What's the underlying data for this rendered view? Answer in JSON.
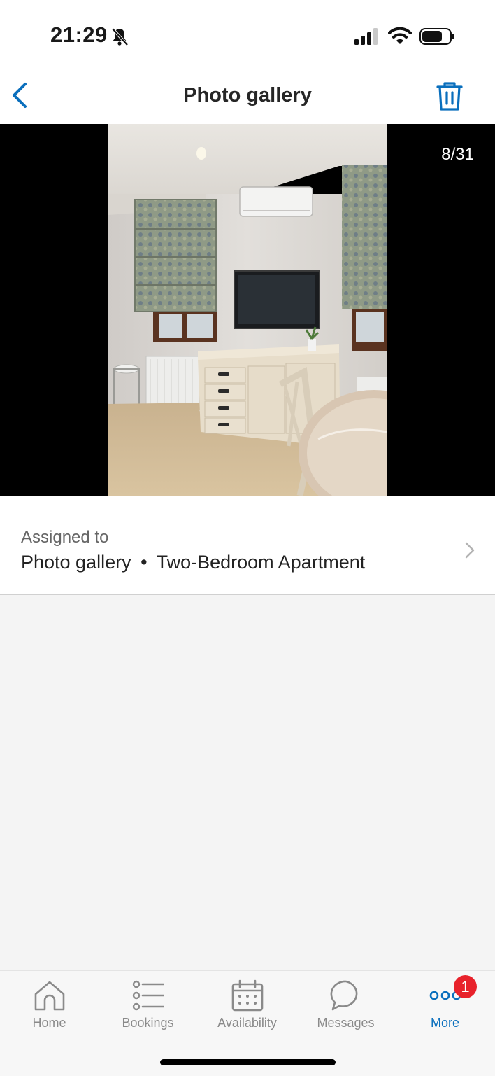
{
  "status": {
    "time": "21:29"
  },
  "header": {
    "title": "Photo gallery"
  },
  "gallery": {
    "counter": "8/31"
  },
  "assigned": {
    "label": "Assigned to",
    "gallery": "Photo gallery",
    "separator": "•",
    "unit": "Two-Bedroom Apartment"
  },
  "tabs": [
    {
      "label": "Home",
      "icon": "home-icon"
    },
    {
      "label": "Bookings",
      "icon": "list-icon"
    },
    {
      "label": "Availability",
      "icon": "calendar-icon"
    },
    {
      "label": "Messages",
      "icon": "chat-icon"
    },
    {
      "label": "More",
      "icon": "more-icon",
      "badge": "1"
    }
  ],
  "colors": {
    "accent": "#0a6fbd",
    "badge": "#e8222b",
    "inactive": "#8a8a8a"
  }
}
